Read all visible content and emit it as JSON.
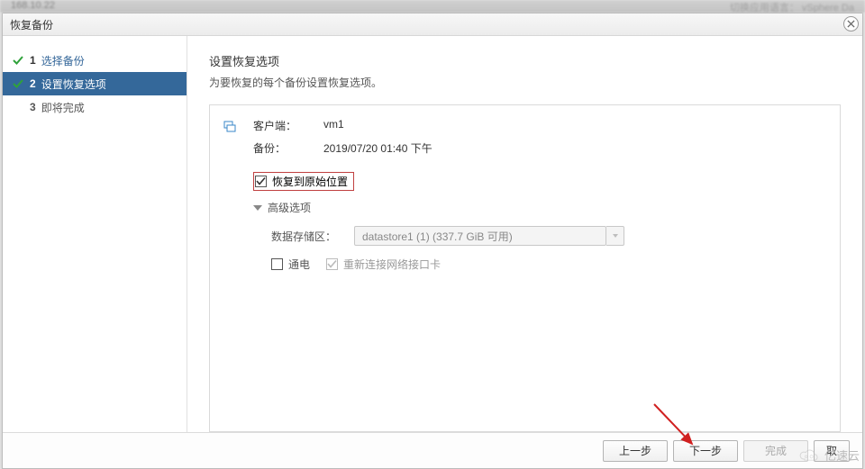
{
  "header_blur": {
    "left": "168.10.22",
    "right_a": "切换应用语言：",
    "right_b": "vSphere Da"
  },
  "dialog": {
    "title": "恢复备份",
    "close_tooltip": "关闭"
  },
  "sidebar": {
    "steps": [
      {
        "num": "1",
        "label": "选择备份",
        "status": "done"
      },
      {
        "num": "2",
        "label": "设置恢复选项",
        "status": "active"
      },
      {
        "num": "3",
        "label": "即将完成",
        "status": "pending"
      }
    ]
  },
  "main": {
    "heading": "设置恢复选项",
    "subheading": "为要恢复的每个备份设置恢复选项。",
    "client_label": "客户端：",
    "client_value": "vm1",
    "backup_label": "备份：",
    "backup_value": "2019/07/20 01:40 下午",
    "restore_original_label": "恢复到原始位置",
    "restore_original_checked": true,
    "advanced_label": "高级选项",
    "datastore_label": "数据存储区：",
    "datastore_value": "datastore1 (1) (337.7 GiB 可用)",
    "power_label": "通电",
    "power_checked": false,
    "reconnect_nic_label": "重新连接网络接口卡",
    "reconnect_nic_checked": true
  },
  "footer": {
    "back": "上一步",
    "next": "下一步",
    "finish": "完成",
    "cancel_short": "取"
  },
  "watermark": "亿速云",
  "colors": {
    "accent": "#34689a",
    "check_green": "#2fa23a",
    "highlight_border": "#c04040"
  }
}
